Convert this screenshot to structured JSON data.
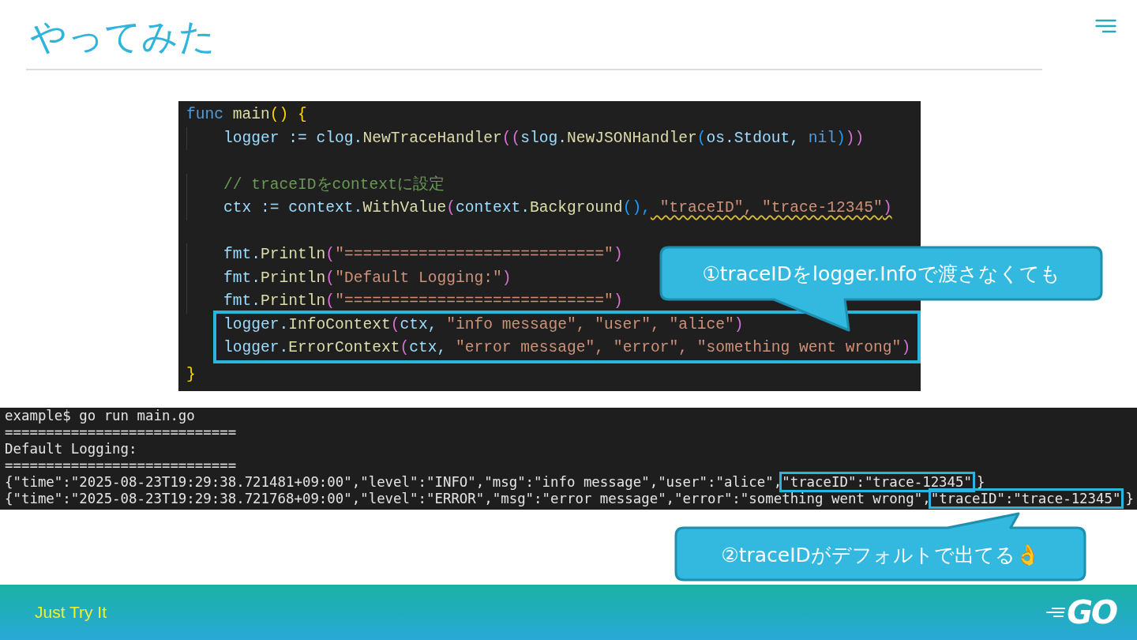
{
  "header": {
    "title": "やってみた"
  },
  "code": {
    "lines": [
      {
        "indented": false,
        "space_before": false,
        "highlighted": false,
        "tokens": [
          {
            "text": "func ",
            "kind": "kw"
          },
          {
            "text": "main",
            "kind": "fn"
          },
          {
            "text": "() {",
            "kind": "b1"
          }
        ]
      },
      {
        "indented": true,
        "space_before": false,
        "highlighted": false,
        "tokens": [
          {
            "text": "logger := clog.",
            "kind": "var"
          },
          {
            "text": "NewTraceHandler",
            "kind": "fn"
          },
          {
            "text": "((",
            "kind": "b2"
          },
          {
            "text": "slog.",
            "kind": "var"
          },
          {
            "text": "NewJSONHandler",
            "kind": "fn"
          },
          {
            "text": "(",
            "kind": "b3"
          },
          {
            "text": "os.Stdout, ",
            "kind": "var"
          },
          {
            "text": "nil",
            "kind": "kw"
          },
          {
            "text": ")",
            "kind": "b3"
          },
          {
            "text": "))",
            "kind": "b2"
          }
        ]
      },
      {
        "indented": true,
        "space_before": true,
        "highlighted": false,
        "tokens": [
          {
            "text": "// traceIDをcontextに設定",
            "kind": "cmt"
          }
        ]
      },
      {
        "indented": true,
        "space_before": false,
        "highlighted": false,
        "tokens": [
          {
            "text": "ctx := context.",
            "kind": "var"
          },
          {
            "text": "WithValue",
            "kind": "fn"
          },
          {
            "text": "(",
            "kind": "b2"
          },
          {
            "text": "context.",
            "kind": "var"
          },
          {
            "text": "Background",
            "kind": "fn"
          },
          {
            "text": "(),",
            "kind": "b3"
          },
          {
            "text": " \"traceID\", \"trace-12345\"",
            "kind": "strw"
          },
          {
            "text": ")",
            "kind": "b2w"
          }
        ]
      },
      {
        "indented": true,
        "space_before": true,
        "highlighted": false,
        "tokens": [
          {
            "text": "fmt.",
            "kind": "var"
          },
          {
            "text": "Println",
            "kind": "fn"
          },
          {
            "text": "(",
            "kind": "b2"
          },
          {
            "text": "\"============================\"",
            "kind": "str"
          },
          {
            "text": ")",
            "kind": "b2"
          }
        ]
      },
      {
        "indented": true,
        "space_before": false,
        "highlighted": false,
        "tokens": [
          {
            "text": "fmt.",
            "kind": "var"
          },
          {
            "text": "Println",
            "kind": "fn"
          },
          {
            "text": "(",
            "kind": "b2"
          },
          {
            "text": "\"Default Logging:\"",
            "kind": "str"
          },
          {
            "text": ")",
            "kind": "b2"
          }
        ]
      },
      {
        "indented": true,
        "space_before": false,
        "highlighted": false,
        "tokens": [
          {
            "text": "fmt.",
            "kind": "var"
          },
          {
            "text": "Println",
            "kind": "fn"
          },
          {
            "text": "(",
            "kind": "b2"
          },
          {
            "text": "\"============================\"",
            "kind": "str"
          },
          {
            "text": ")",
            "kind": "b2"
          }
        ]
      },
      {
        "indented": true,
        "space_before": false,
        "highlighted": true,
        "tokens": [
          {
            "text": "logger.",
            "kind": "var"
          },
          {
            "text": "InfoContext",
            "kind": "fn"
          },
          {
            "text": "(",
            "kind": "b2"
          },
          {
            "text": "ctx, ",
            "kind": "var"
          },
          {
            "text": "\"info message\", \"user\", \"alice\"",
            "kind": "str"
          },
          {
            "text": ")",
            "kind": "b2"
          }
        ]
      },
      {
        "indented": true,
        "space_before": false,
        "highlighted": true,
        "tokens": [
          {
            "text": "logger.",
            "kind": "var"
          },
          {
            "text": "ErrorContext",
            "kind": "fn"
          },
          {
            "text": "(",
            "kind": "b2"
          },
          {
            "text": "ctx, ",
            "kind": "var"
          },
          {
            "text": "\"error message\", \"error\", \"something went wrong\"",
            "kind": "str"
          },
          {
            "text": ")",
            "kind": "b2"
          }
        ]
      },
      {
        "indented": false,
        "space_before": false,
        "highlighted": false,
        "tokens": [
          {
            "text": "}",
            "kind": "b1"
          }
        ]
      }
    ]
  },
  "terminal": {
    "lines": [
      [
        {
          "text": "example$ go run main.go",
          "boxed": false
        }
      ],
      [
        {
          "text": "============================",
          "boxed": false
        }
      ],
      [
        {
          "text": "Default Logging:",
          "boxed": false
        }
      ],
      [
        {
          "text": "============================",
          "boxed": false
        }
      ],
      [
        {
          "text": "{\"time\":\"2025-08-23T19:29:38.721481+09:00\",\"level\":\"INFO\",\"msg\":\"info message\",\"user\":\"alice\",",
          "boxed": false
        },
        {
          "text": "\"traceID\":\"trace-12345\"",
          "boxed": true
        },
        {
          "text": "}",
          "boxed": false
        }
      ],
      [
        {
          "text": "{\"time\":\"2025-08-23T19:29:38.721768+09:00\",\"level\":\"ERROR\",\"msg\":\"error message\",\"error\":\"something went wrong\",",
          "boxed": false
        },
        {
          "text": "\"traceID\":\"trace-12345\"",
          "boxed": true
        },
        {
          "text": "}",
          "boxed": false
        }
      ]
    ]
  },
  "callouts": [
    {
      "text": "①traceIDをlogger.Infoで渡さなくても",
      "kind": "down"
    },
    {
      "text": "②traceIDがデフォルトで出てる👌",
      "kind": "up"
    }
  ],
  "footer": {
    "caption": "Just Try It",
    "logo": "GO"
  }
}
